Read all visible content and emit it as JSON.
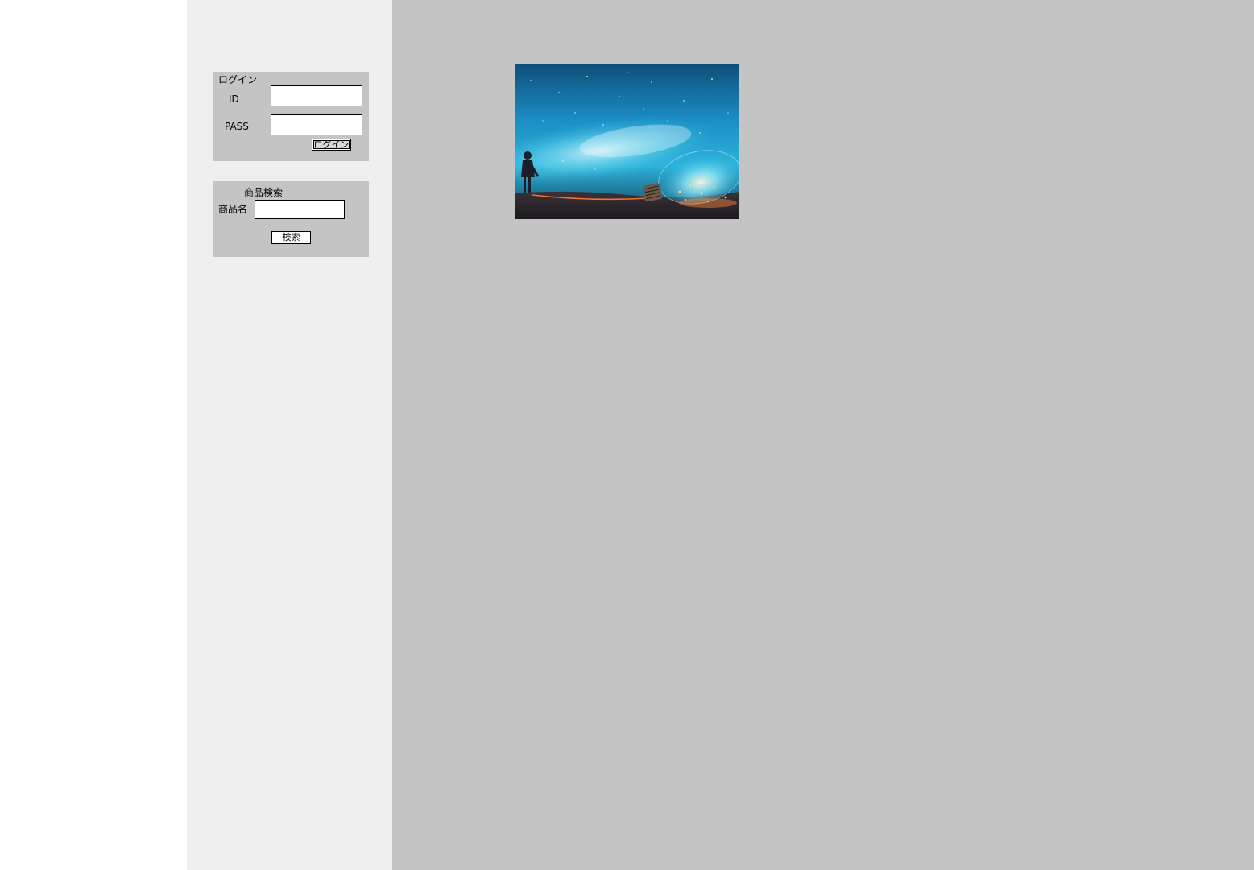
{
  "login": {
    "title": "ログイン",
    "id_label": "ID",
    "pass_label": "PASS",
    "id_value": "",
    "pass_value": "",
    "button_label": "ログイン"
  },
  "search": {
    "title": "商品検索",
    "name_label": "商品名",
    "name_value": "",
    "button_label": "検索"
  },
  "colors": {
    "sidebar_bg": "#efefef",
    "panel_bg": "#c4c4c4",
    "main_bg": "#c4c4c4"
  }
}
